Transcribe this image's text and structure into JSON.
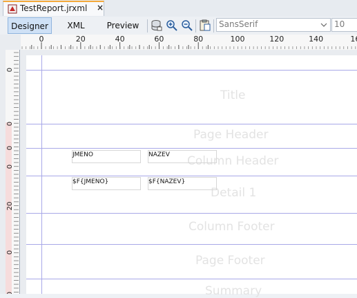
{
  "tab": {
    "title": "TestReport.jrxml",
    "close_glyph": "×",
    "icon": "report-file-icon"
  },
  "toolbar": {
    "modes": [
      "Designer",
      "XML",
      "Preview"
    ],
    "active_mode": "Designer",
    "icons": [
      "database-icon",
      "zoom-in-icon",
      "zoom-out-icon",
      "clipboard-icon"
    ],
    "font_name": "SansSerif",
    "font_size": "10"
  },
  "ruler": {
    "h_labels": [
      "0",
      "20",
      "40",
      "60",
      "80",
      "100",
      "120",
      "140",
      "16"
    ],
    "v_labels": [
      "0",
      "0",
      "0",
      "0",
      "20",
      "0",
      "0"
    ]
  },
  "bands": [
    {
      "label": "Title"
    },
    {
      "label": "Page Header"
    },
    {
      "label": "Column Header"
    },
    {
      "label": "Detail 1"
    },
    {
      "label": "Column Footer"
    },
    {
      "label": "Page Footer"
    },
    {
      "label": "Summary"
    }
  ],
  "fields": {
    "header_jmeno": "JMENO",
    "header_nazev": "NAZEV",
    "detail_jmeno": "$F{JMENO}",
    "detail_nazev": "$F{NAZEV}"
  },
  "colors": {
    "band_line": "#a8a8e8",
    "active_mode_bg": "#cfe1f6",
    "tab_accent": "#f4a93a",
    "band_label": "#e3e3e3"
  }
}
